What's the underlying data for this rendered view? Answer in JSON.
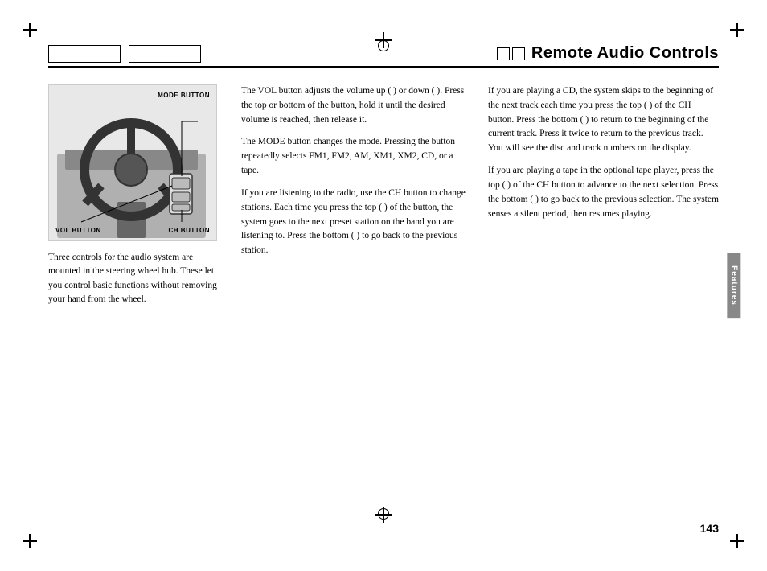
{
  "page": {
    "title": "Remote Audio Controls",
    "page_number": "143",
    "features_label": "Features"
  },
  "header": {
    "tabs": [
      "",
      ""
    ],
    "squares": [
      "",
      ""
    ]
  },
  "diagram": {
    "mode_button_label": "MODE BUTTON",
    "vol_button_label": "VOL BUTTON",
    "ch_button_label": "CH BUTTON"
  },
  "caption": "Three controls for the audio system are mounted in the steering wheel hub. These let you control basic functions without removing your hand from the wheel.",
  "col_middle": {
    "para1": "The VOL button adjusts the volume up (     ) or down (     ). Press the top or bottom of the button, hold it until the desired volume is reached, then release it.",
    "para2": "The MODE button changes the mode. Pressing the button repeatedly selects FM1, FM2, AM, XM1, XM2, CD, or a tape.",
    "para3": "If you are listening to the radio, use the CH button to change stations. Each time you press the top (     ) of the button, the system goes to the next preset station on the band you are listening to. Press the bottom (     ) to go back to the previous station."
  },
  "col_right": {
    "para1": "If you are playing a CD, the system skips to the beginning of the next track each time you press the top (     ) of the CH button. Press the bottom (     ) to return to the beginning of the current track. Press it twice to return to the previous track. You will see the disc and track numbers on the display.",
    "para2": "If you are playing a tape in the optional tape player, press the top (     ) of the CH button to advance to the next selection. Press the bottom (     ) to go back to the previous selection. The system senses a silent period, then resumes playing."
  }
}
